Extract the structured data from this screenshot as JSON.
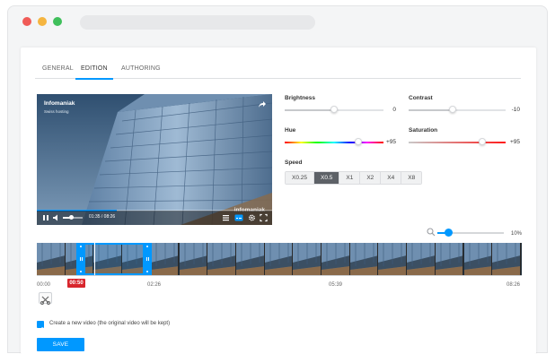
{
  "tabs": [
    {
      "label": "GENERAL"
    },
    {
      "label": "EDITION"
    },
    {
      "label": "AUTHORING"
    }
  ],
  "active_tab": "EDITION",
  "video": {
    "brand": "Infomaniak",
    "brand_subtitle": "Swiss hosting",
    "watermark": "infomaniak",
    "time": "01:35 / 08:26",
    "progress": 0.34
  },
  "adjustments": {
    "brightness": {
      "label": "Brightness",
      "value": "0"
    },
    "contrast": {
      "label": "Contrast",
      "value": "-10"
    },
    "hue": {
      "label": "Hue",
      "value": "+95"
    },
    "saturation": {
      "label": "Saturation",
      "value": "+95"
    }
  },
  "speed": {
    "label": "Speed",
    "options": [
      "X0.25",
      "X0.5",
      "X1",
      "X2",
      "X4",
      "X8"
    ],
    "selected": "X0.5"
  },
  "zoom": {
    "value": "10%"
  },
  "timeline": {
    "ticks": [
      "00:00",
      "02:26",
      "05:39",
      "08:26"
    ],
    "current_time": "00:50"
  },
  "create_new": {
    "checked": true,
    "label": "Create a new video (the original video will be kept)"
  },
  "save_label": "SAVE",
  "colors": {
    "accent": "#0098ff",
    "current_time_badge": "#d8252c",
    "speed_active": "#5d6167"
  },
  "icons": [
    "share-icon",
    "play-pause-icon",
    "volume-icon",
    "playlist-icon",
    "subtitles-icon",
    "settings-icon",
    "fullscreen-icon",
    "zoom-search-icon",
    "cut-icon",
    "check-icon"
  ]
}
